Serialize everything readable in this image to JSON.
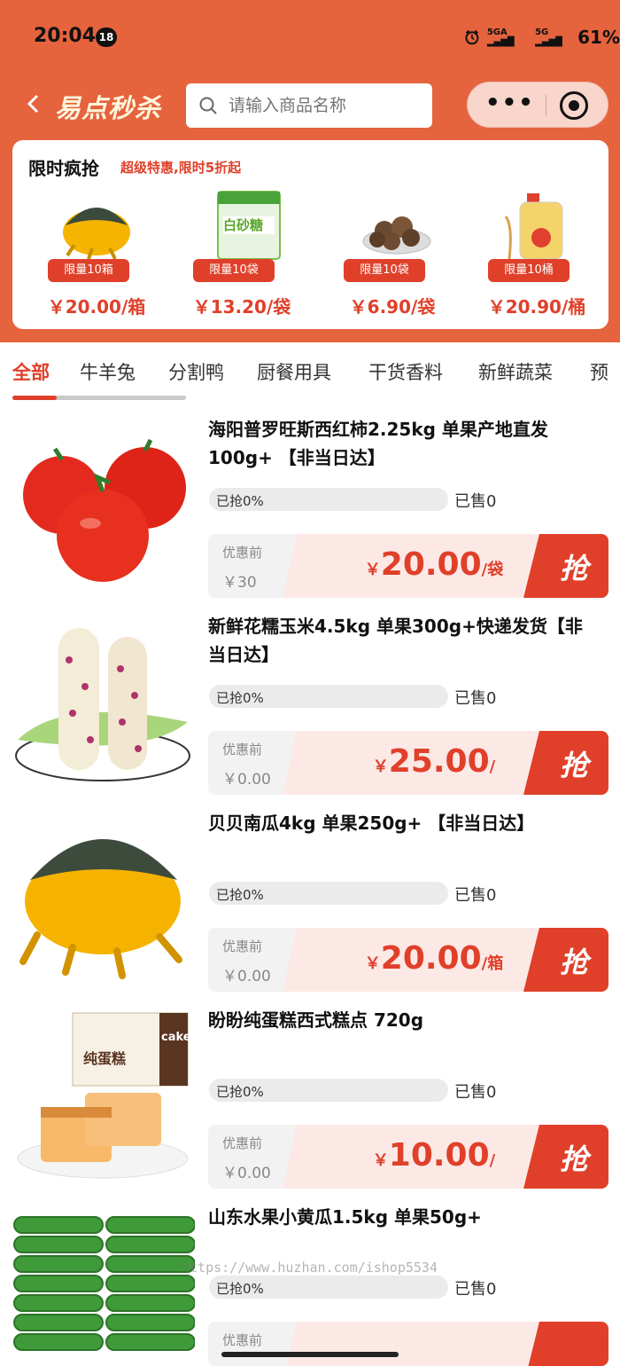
{
  "status_bar": {
    "time": "20:04",
    "age_badge": "18",
    "network1": "5GA",
    "network2": "5G",
    "battery": "61%"
  },
  "header": {
    "logo": "易点秒杀",
    "search_placeholder": "请输入商品名称",
    "more": "•••"
  },
  "flash_sale": {
    "title": "限时疯抢",
    "subtitle": "超级特惠,限时5折起",
    "items": [
      {
        "tag": "限量10箱",
        "price": "￥20.00/箱",
        "icon": "pumpkin-image"
      },
      {
        "tag": "限量10袋",
        "price": "￥13.20/袋",
        "icon": "sugar-bag-image",
        "package_text": "白砂糖"
      },
      {
        "tag": "限量10袋",
        "price": "￥6.90/袋",
        "icon": "mushroom-image"
      },
      {
        "tag": "限量10桶",
        "price": "￥20.90/桶",
        "icon": "oil-bottle-image"
      }
    ]
  },
  "tabs": [
    "全部",
    "牛羊兔",
    "分割鸭",
    "厨餐用具",
    "干货香料",
    "新鲜蔬菜",
    "预"
  ],
  "active_tab": "全部",
  "products": [
    {
      "name": "海阳普罗旺斯西红柿2.25kg 单果产地直发100g+ 【非当日达】",
      "progress_label": "已抢0%",
      "progress": 0,
      "sold": "已售0",
      "orig_label": "优惠前",
      "orig_price": "￥30",
      "currency": "￥",
      "price": "20.00",
      "unit": "/袋",
      "grab": "抢",
      "icon": "tomato-image"
    },
    {
      "name": "新鲜花糯玉米4.5kg 单果300g+快递发货【非当日达】",
      "progress_label": "已抢0%",
      "progress": 0,
      "sold": "已售0",
      "orig_label": "优惠前",
      "orig_price": "￥0.00",
      "currency": "￥",
      "price": "25.00",
      "unit": "/",
      "grab": "抢",
      "icon": "corn-image"
    },
    {
      "name": "贝贝南瓜4kg 单果250g+ 【非当日达】",
      "progress_label": "已抢0%",
      "progress": 0,
      "sold": "已售0",
      "orig_label": "优惠前",
      "orig_price": "￥0.00",
      "currency": "￥",
      "price": "20.00",
      "unit": "/箱",
      "grab": "抢",
      "icon": "pumpkin-image"
    },
    {
      "name": "盼盼纯蛋糕西式糕点 720g",
      "progress_label": "已抢0%",
      "progress": 0,
      "sold": "已售0",
      "orig_label": "优惠前",
      "orig_price": "￥0.00",
      "currency": "￥",
      "price": "10.00",
      "unit": "/",
      "grab": "抢",
      "icon": "cake-image",
      "box_text": "纯蛋糕",
      "box_text2": "cake"
    },
    {
      "name": "山东水果小黄瓜1.5kg 单果50g+",
      "progress_label": "已抢0%",
      "progress": 0,
      "sold": "已售0",
      "orig_label": "优惠前",
      "orig_price": "",
      "currency": "",
      "price": "",
      "unit": "",
      "grab": "",
      "icon": "cucumber-image"
    }
  ],
  "watermark": "https://www.huzhan.com/ishop5534"
}
